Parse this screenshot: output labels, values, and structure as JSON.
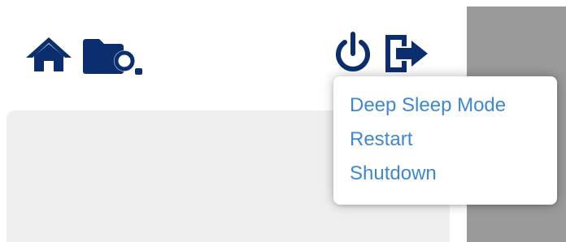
{
  "toolbar": {
    "left_icons": [
      "home-icon",
      "folder-search-icon"
    ],
    "right_icons": [
      "power-icon",
      "logout-icon"
    ]
  },
  "power_menu": {
    "items": [
      {
        "label": "Deep Sleep Mode"
      },
      {
        "label": "Restart"
      },
      {
        "label": "Shutdown"
      }
    ]
  },
  "colors": {
    "icon": "#0b2f6e",
    "menu_text": "#3d88d6",
    "panel_bg": "#efefef",
    "side_strip": "#9a9a9a"
  }
}
